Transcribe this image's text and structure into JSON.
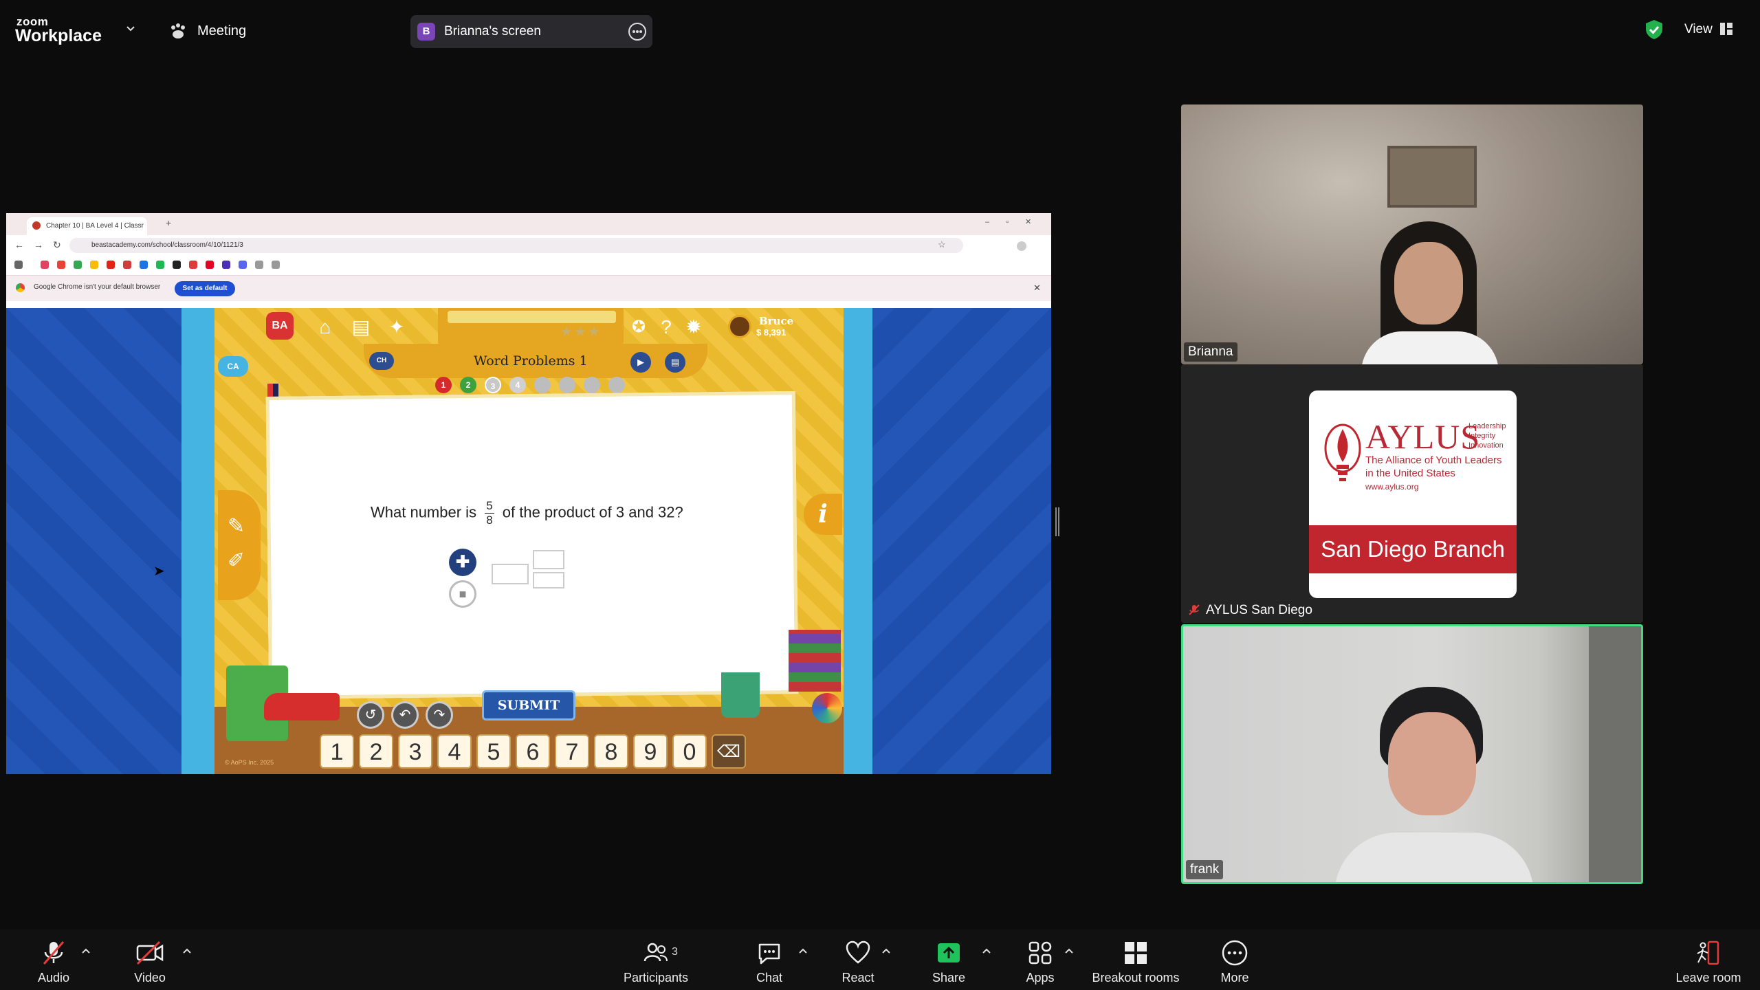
{
  "app": {
    "brand_small": "zoom",
    "brand_big": "Workplace",
    "meeting_label": "Meeting",
    "share_avatar_letter": "B",
    "share_label": "Brianna's screen",
    "view_label": "View"
  },
  "browser": {
    "tab_title": "Chapter 10 | BA Level 4 | Classr",
    "url": "beastacademy.com/school/classroom/4/10/1121/3",
    "infobar_text": "Google Chrome isn't your default browser",
    "infobar_button": "Set as default"
  },
  "game": {
    "logo": "BA",
    "user_name": "Bruce",
    "user_coins": "8,391",
    "title": "Word Problems 1",
    "ca_badge": "CA",
    "side_badge": "CH",
    "progress_dots": [
      {
        "label": "1",
        "state": "incorrect",
        "color": "#d42a2a"
      },
      {
        "label": "2",
        "state": "correct",
        "color": "#3da23d"
      },
      {
        "label": "3",
        "state": "current",
        "color": "#c8c8c8"
      },
      {
        "label": "4",
        "state": "upcoming",
        "color": "#d0d0d0"
      },
      {
        "label": "",
        "state": "locked",
        "color": "#bdbdbd"
      },
      {
        "label": "",
        "state": "locked",
        "color": "#bdbdbd"
      },
      {
        "label": "",
        "state": "locked",
        "color": "#bdbdbd"
      },
      {
        "label": "",
        "state": "locked",
        "color": "#bdbdbd"
      }
    ],
    "question_before": "What number is",
    "fraction_num": "5",
    "fraction_den": "8",
    "question_after": "of the product of 3 and 32?",
    "submit": "SUBMIT",
    "keypad": [
      "1",
      "2",
      "3",
      "4",
      "5",
      "6",
      "7",
      "8",
      "9",
      "0"
    ],
    "info_icon": "i",
    "copyright": "© AoPS Inc. 2025"
  },
  "participants_tiles": [
    {
      "name": "Brianna"
    },
    {
      "name": "AYLUS San Diego",
      "muted": true
    },
    {
      "name": "frank",
      "active_speaker": true
    }
  ],
  "aylus_logo": {
    "title": "AYLUS",
    "side_words": [
      "Leadership",
      "Integrity",
      "Innovation"
    ],
    "subtitle_line1": "The Alliance of Youth Leaders",
    "subtitle_line2": "in the United States",
    "url": "www.aylus.org",
    "branch": "San Diego Branch",
    "brand_color": "#c1262f"
  },
  "toolbar": {
    "audio": "Audio",
    "video": "Video",
    "participants": "Participants",
    "participants_count": "3",
    "chat": "Chat",
    "react": "React",
    "share": "Share",
    "apps": "Apps",
    "breakout": "Breakout rooms",
    "more": "More",
    "leave": "Leave room",
    "share_color": "#20c35b",
    "muted_color": "#e53b3b"
  }
}
